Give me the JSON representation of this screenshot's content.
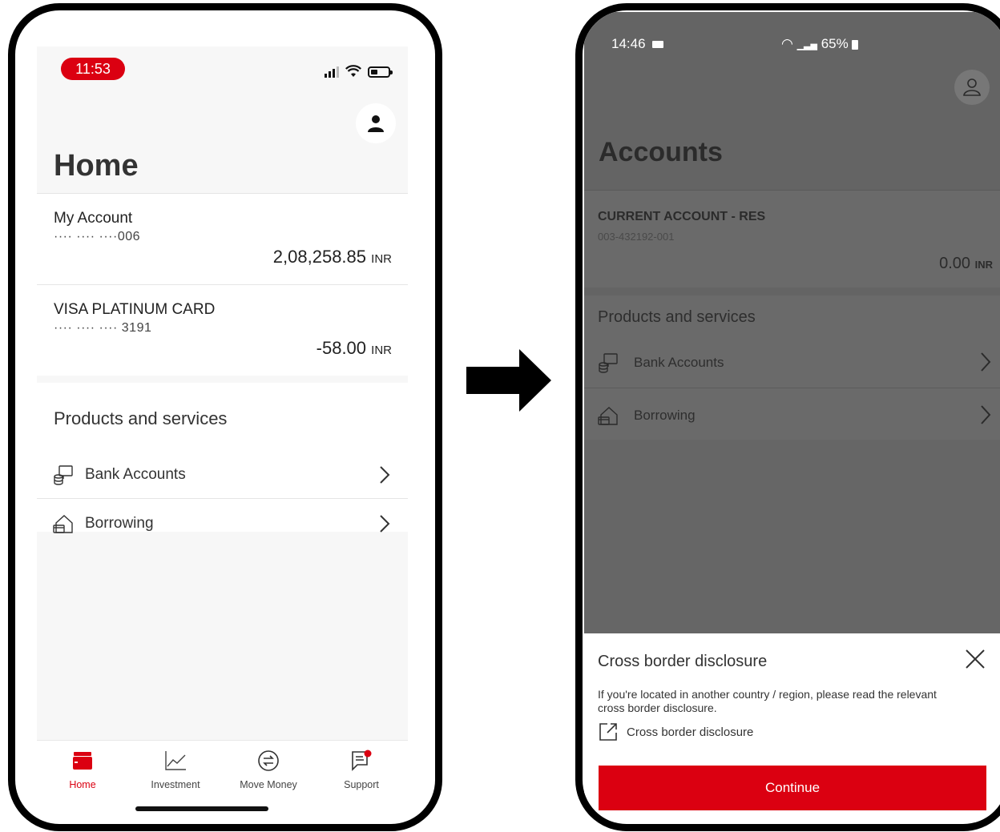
{
  "left_phone": {
    "status": {
      "time": "11:53"
    },
    "page_title": "Home",
    "accounts": [
      {
        "name": "My Account",
        "number": "···· ···· ····006",
        "balance": "2,08,258.85",
        "currency": "INR"
      },
      {
        "name": "VISA PLATINUM CARD",
        "number": "···· ···· ···· 3191",
        "balance": "-58.00",
        "currency": "INR"
      }
    ],
    "products": {
      "title": "Products and services",
      "items": [
        {
          "label": "Bank Accounts",
          "icon": "bank-accounts-icon"
        },
        {
          "label": "Borrowing",
          "icon": "borrowing-icon"
        }
      ]
    },
    "tabs": [
      {
        "label": "Home",
        "icon": "wallet-icon",
        "active": true
      },
      {
        "label": "Investment",
        "icon": "chart-icon"
      },
      {
        "label": "Move Money",
        "icon": "transfer-icon"
      },
      {
        "label": "Support",
        "icon": "chat-icon"
      }
    ],
    "accent_color": "#db0011"
  },
  "right_phone": {
    "status": {
      "time": "14:46",
      "battery": "65%"
    },
    "page_title": "Accounts",
    "account": {
      "name": "CURRENT ACCOUNT - RES",
      "number": "003-432192-001",
      "balance": "0.00",
      "currency": "INR"
    },
    "products": {
      "title": "Products and services",
      "items": [
        {
          "label": "Bank Accounts",
          "icon": "bank-accounts-icon"
        },
        {
          "label": "Borrowing",
          "icon": "borrowing-icon"
        }
      ]
    },
    "sheet": {
      "title": "Cross border disclosure",
      "text": "If you're located in another country / region, please read the relevant cross border disclosure.",
      "link": "Cross border disclosure",
      "button": "Continue"
    },
    "overlay_color": "#646464"
  }
}
